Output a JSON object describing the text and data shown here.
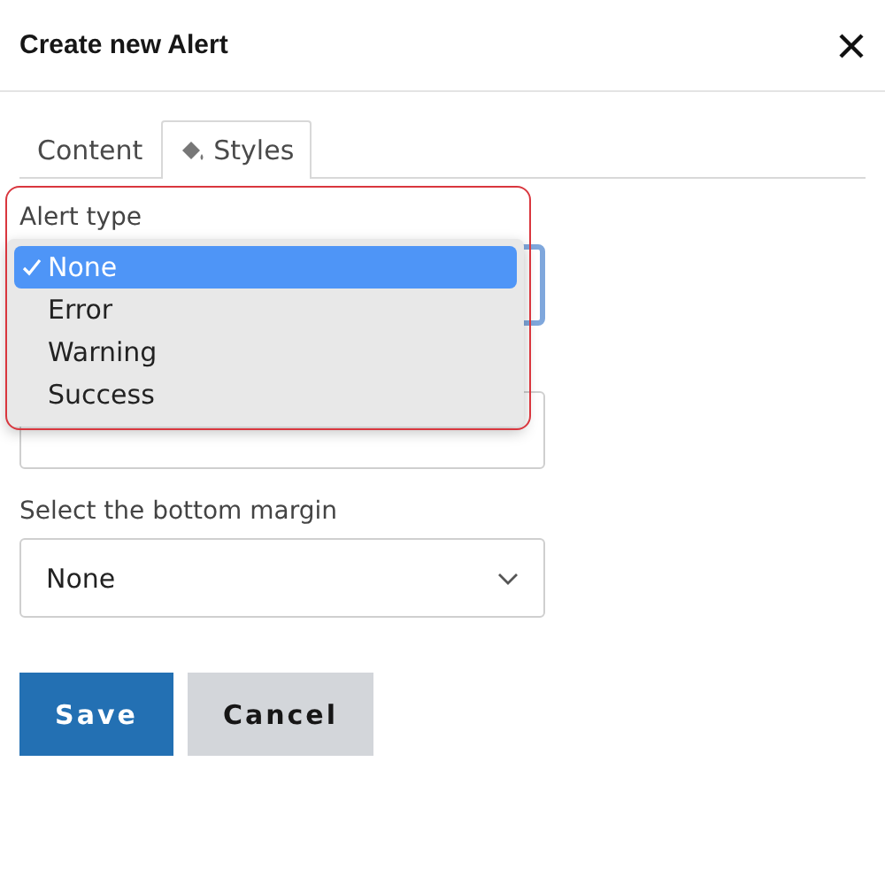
{
  "dialog": {
    "title": "Create new Alert"
  },
  "tabs": [
    {
      "label": "Content",
      "selected": false,
      "kind": "plain"
    },
    {
      "label": "Styles",
      "selected": true,
      "kind": "paint"
    }
  ],
  "alert_type": {
    "label": "Alert type",
    "options": [
      {
        "label": "None",
        "selected": true
      },
      {
        "label": "Error",
        "selected": false
      },
      {
        "label": "Warning",
        "selected": false
      },
      {
        "label": "Success",
        "selected": false
      }
    ]
  },
  "bottom_margin": {
    "label": "Select the bottom margin",
    "value": "None"
  },
  "buttons": [
    {
      "label": "Save",
      "kind": "primary"
    },
    {
      "label": "Cancel",
      "kind": "secondary"
    }
  ]
}
